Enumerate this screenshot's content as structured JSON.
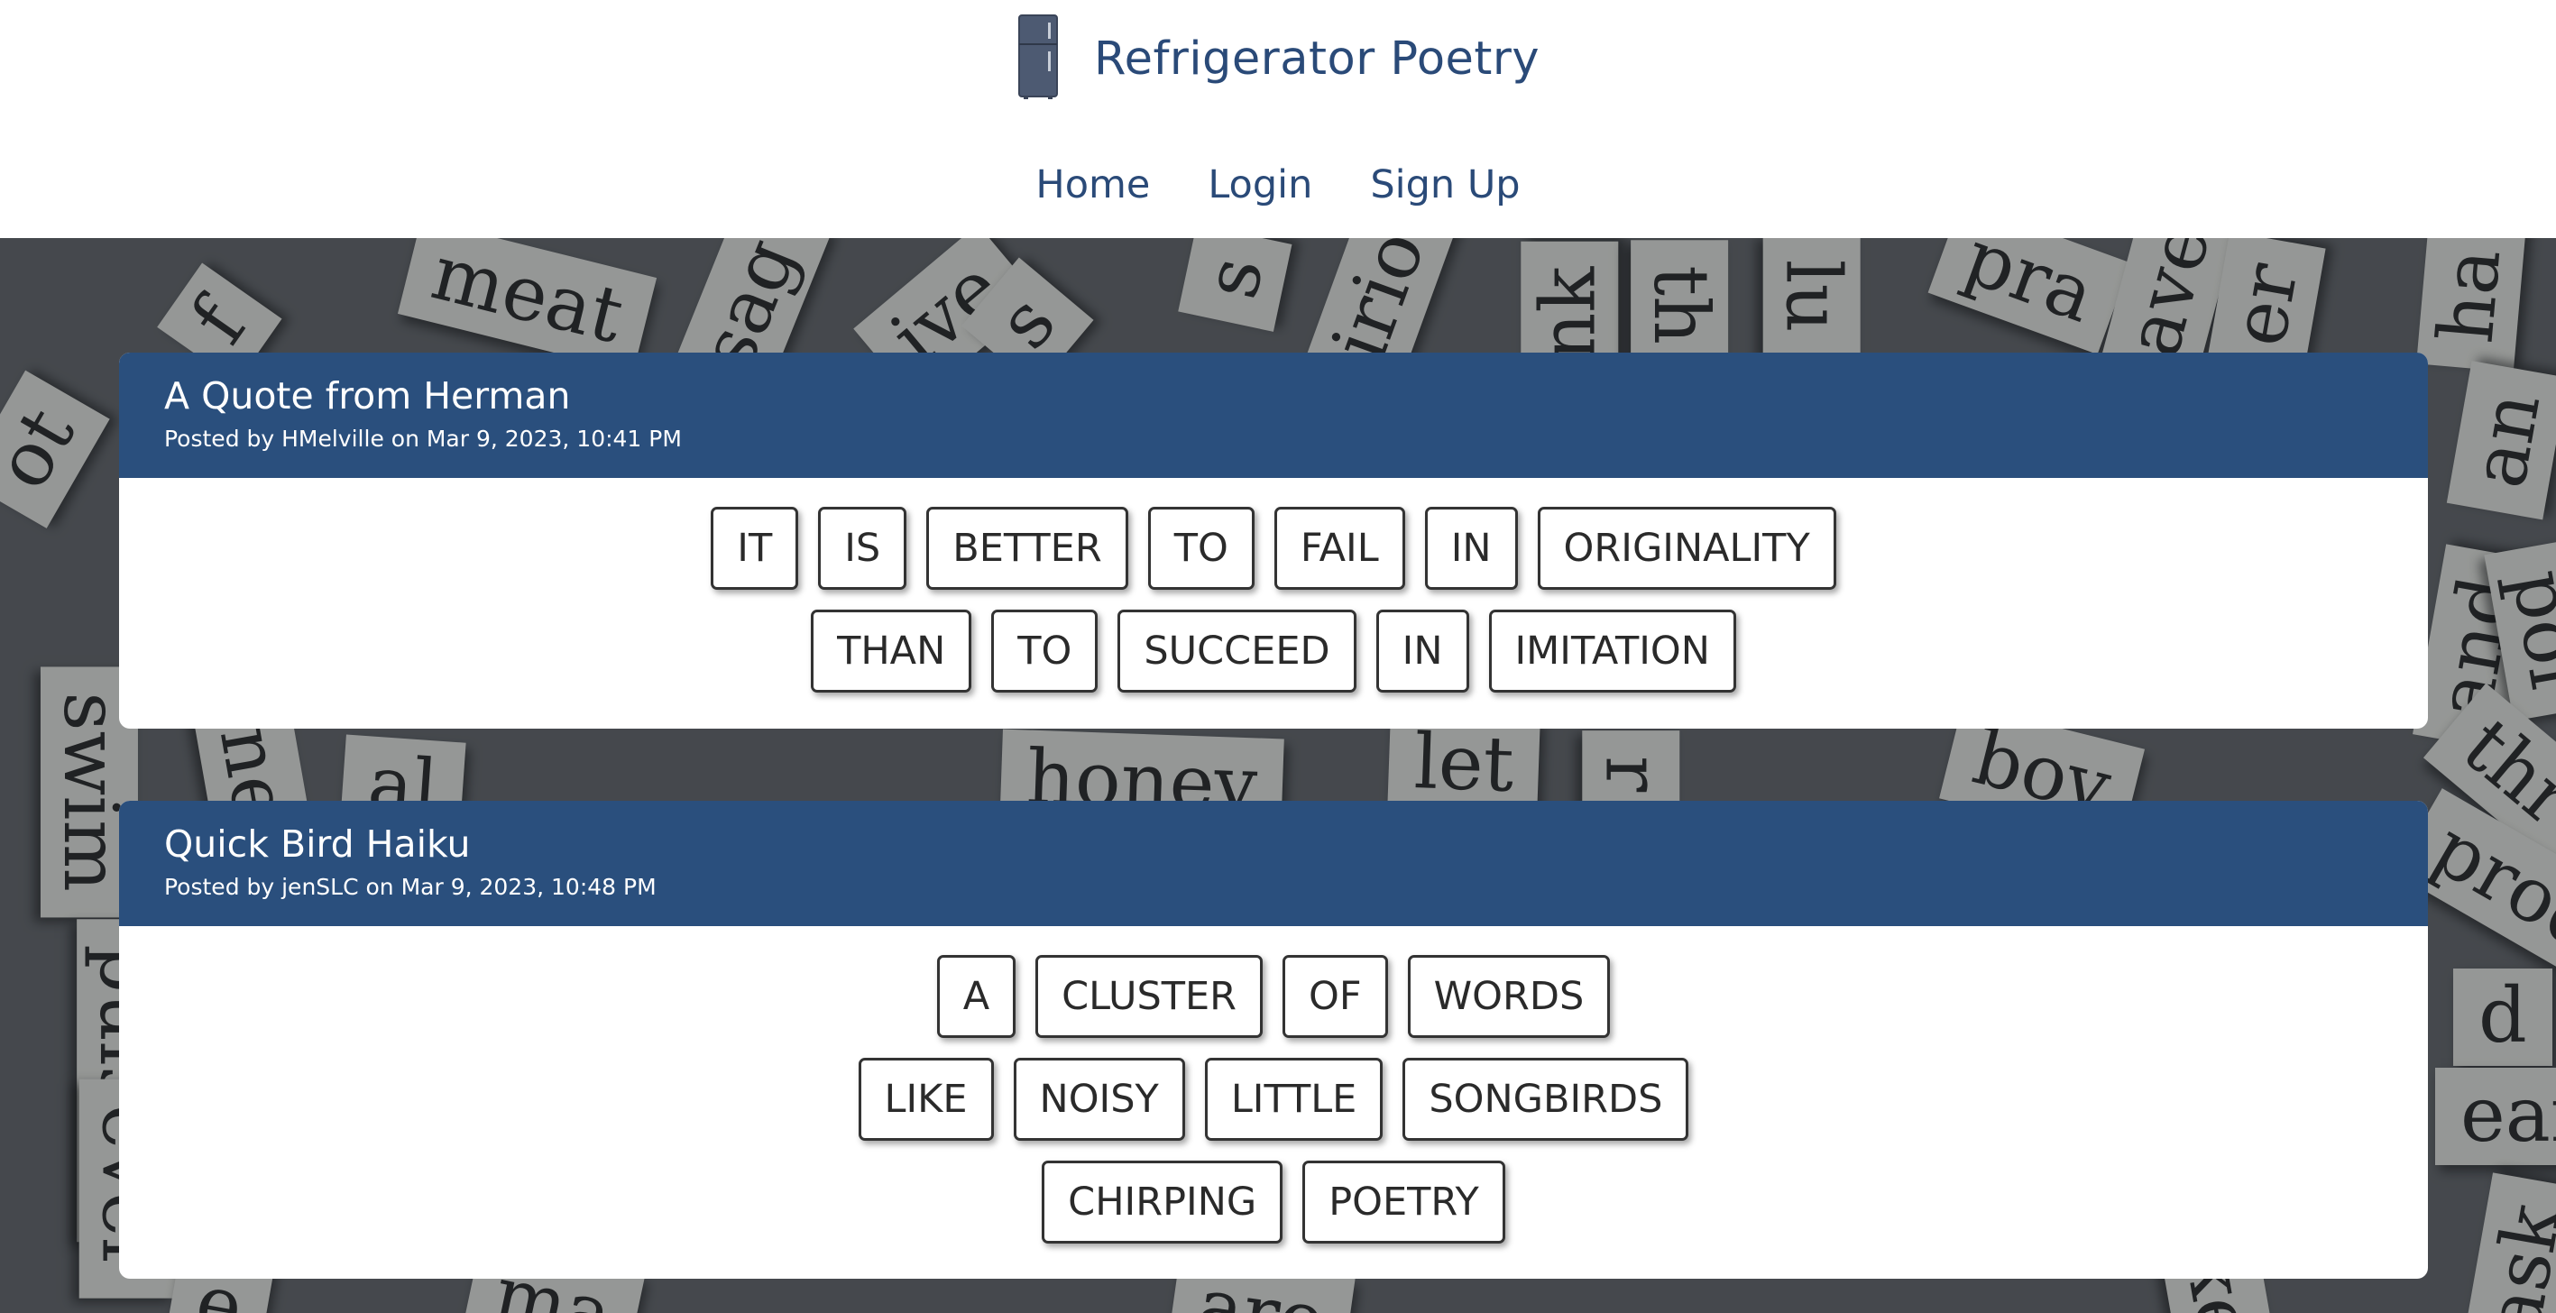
{
  "site": {
    "title": "Refrigerator Poetry",
    "logo_icon": "refrigerator-icon",
    "colors": {
      "brand": "#2a4a78",
      "card_header": "#2a4f7d",
      "tile_border": "#333333"
    }
  },
  "nav": {
    "home": "Home",
    "login": "Login",
    "signup": "Sign Up"
  },
  "background_words": [
    "meat",
    "sag",
    "ive",
    "s",
    "s",
    "irio",
    "nk",
    "th",
    "lu",
    "pra",
    "have",
    "er",
    "ha",
    "an",
    "and",
    "pol",
    "ot",
    "f",
    "swim",
    "pulsive",
    "ne",
    "al",
    "honey",
    "let",
    "r",
    "boy",
    "thr",
    "produ",
    "d",
    "ean",
    "ever",
    "ask",
    "e",
    "ma",
    "are",
    "ke"
  ],
  "poems": [
    {
      "title": "A Quote from Herman",
      "meta": "Posted by HMelville on Mar 9, 2023, 10:41 PM",
      "rows": [
        [
          "IT",
          "IS",
          "BETTER",
          "TO",
          "FAIL",
          "IN",
          "ORIGINALITY"
        ],
        [
          "THAN",
          "TO",
          "SUCCEED",
          "IN",
          "IMITATION"
        ]
      ]
    },
    {
      "title": "Quick Bird Haiku",
      "meta": "Posted by jenSLC on Mar 9, 2023, 10:48 PM",
      "rows": [
        [
          "A",
          "CLUSTER",
          "OF",
          "WORDS"
        ],
        [
          "LIKE",
          "NOISY",
          "LITTLE",
          "SONGBIRDS"
        ],
        [
          "CHIRPING",
          "POETRY"
        ]
      ]
    }
  ]
}
